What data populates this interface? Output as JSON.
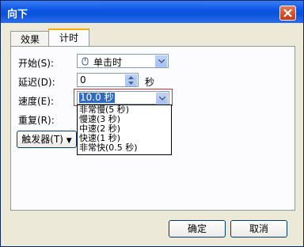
{
  "window": {
    "title": "向下"
  },
  "tabs": [
    {
      "label": "效果",
      "active": false
    },
    {
      "label": "计时",
      "active": true
    }
  ],
  "form": {
    "start_label": "开始(S):",
    "start_value": "单击时",
    "delay_label": "延迟(D):",
    "delay_value": "0",
    "delay_unit": "秒",
    "speed_label": "速度(E):",
    "speed_value": "10.0 秒",
    "repeat_label": "重复(R):",
    "trigger_label": "触发器(T)"
  },
  "speed_options": [
    "非常慢(5 秒)",
    "慢速(3 秒)",
    "中速(2 秒)",
    "快速(1 秒)",
    "非常快(0.5 秒)"
  ],
  "buttons": {
    "ok": "确定",
    "cancel": "取消"
  },
  "colors": {
    "title_bar": "#0b58e6",
    "highlight": "#316ac5",
    "focus_border": "#d32f2f"
  }
}
